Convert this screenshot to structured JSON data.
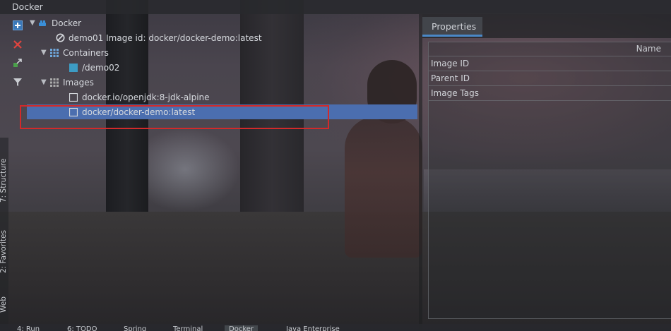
{
  "window": {
    "title": "Docker"
  },
  "toolbar": {
    "buttons": [
      {
        "icon": "add-icon"
      },
      {
        "icon": "delete-icon"
      },
      {
        "icon": "deploy-icon"
      },
      {
        "icon": "filter-icon"
      }
    ]
  },
  "tree": {
    "root": {
      "label": "Docker",
      "icon": "docker-icon"
    },
    "deployment": {
      "label": "demo01 Image id: docker/docker-demo:latest",
      "icon": "no-entry-icon"
    },
    "containers": {
      "label": "Containers",
      "icon": "grid-icon"
    },
    "container_items": [
      {
        "label": "/demo02",
        "icon": "container-icon"
      }
    ],
    "images": {
      "label": "Images",
      "icon": "grid-icon"
    },
    "image_items": [
      {
        "label": "docker.io/openjdk:8-jdk-alpine",
        "icon": "image-icon"
      },
      {
        "label": "docker/docker-demo:latest",
        "icon": "image-icon",
        "selected": true
      }
    ]
  },
  "properties": {
    "tab_label": "Properties",
    "column_header": "Name",
    "rows": [
      "Image ID",
      "Parent ID",
      "Image Tags"
    ]
  },
  "side_tabs": [
    "7: Structure",
    "2: Favorites",
    "Web"
  ],
  "bottom_tabs": [
    "4: Run",
    "6: TODO",
    "Spring",
    "Terminal",
    "Docker",
    "Java Enterprise"
  ],
  "colors": {
    "selection": "#4b6eaf",
    "highlight_box": "#d22a2a",
    "tab_underline": "#4a88c7"
  }
}
